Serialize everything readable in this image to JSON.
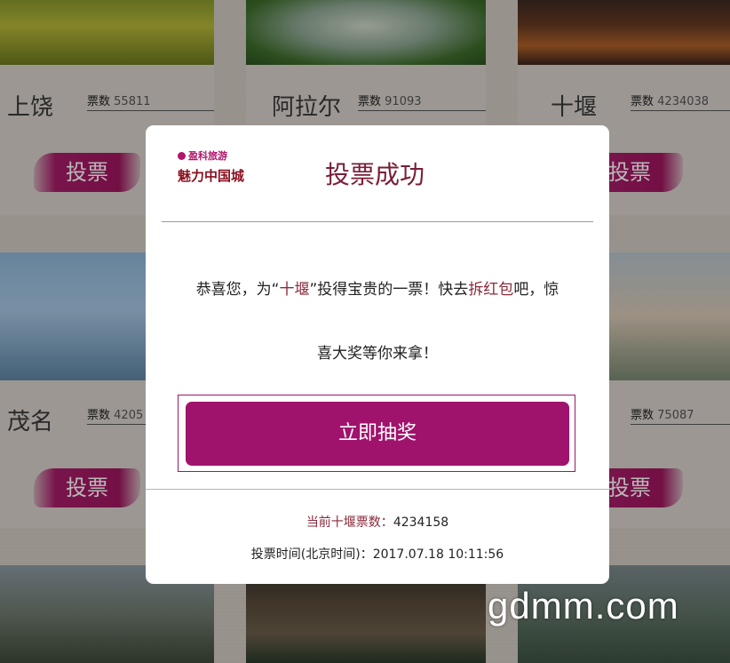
{
  "cards": [
    {
      "name": "上饶",
      "votes_label": "票数",
      "votes": "55811",
      "button": "投票"
    },
    {
      "name": "阿拉尔",
      "votes_label": "票数",
      "votes": "91093"
    },
    {
      "name": "十堰",
      "votes_label": "票数",
      "votes": "4234038",
      "button": "投票"
    },
    {
      "name": "茂名",
      "votes_label": "票数",
      "votes": "4205",
      "button": "投票"
    },
    {
      "votes_label": "票数",
      "votes": "75087",
      "button": "投票"
    }
  ],
  "modal": {
    "brand_top": "盈科旅游",
    "brand_main": "魅力中国城",
    "title": "投票成功",
    "message_1": "恭喜您，为“",
    "message_city": "十堰",
    "message_2": "”投得宝贵的一票！快去",
    "message_link": "拆红包",
    "message_3": "吧，惊",
    "message_line2": "喜大奖等你来拿！",
    "lottery_button": "立即抽奖",
    "current_votes_label": "当前十堰票数：",
    "current_votes_value": "4234158",
    "vote_time": "投票时间(北京时间)：2017.07.18 10:11:56"
  },
  "watermark": "gdmm.com",
  "colors": {
    "accent": "#a0136c",
    "title": "#7a1d35"
  }
}
